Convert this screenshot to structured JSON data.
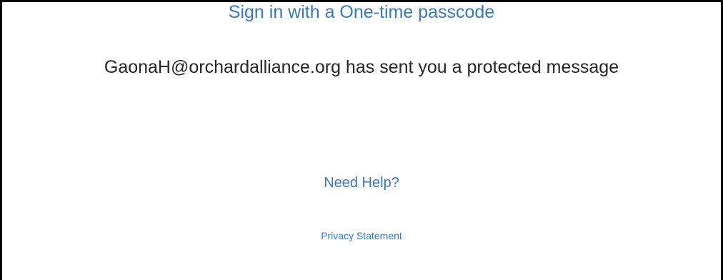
{
  "message": {
    "sender_text": "GaonaH@orchardalliance.org has sent you a protected message"
  },
  "actions": {
    "otp_sign_in_label": "Sign in with a One-time passcode",
    "need_help_label": "Need Help?",
    "privacy_statement_label": "Privacy Statement"
  },
  "colors": {
    "link": "#3b79b6",
    "text": "#262626",
    "border": "#000000",
    "background": "#ffffff"
  }
}
